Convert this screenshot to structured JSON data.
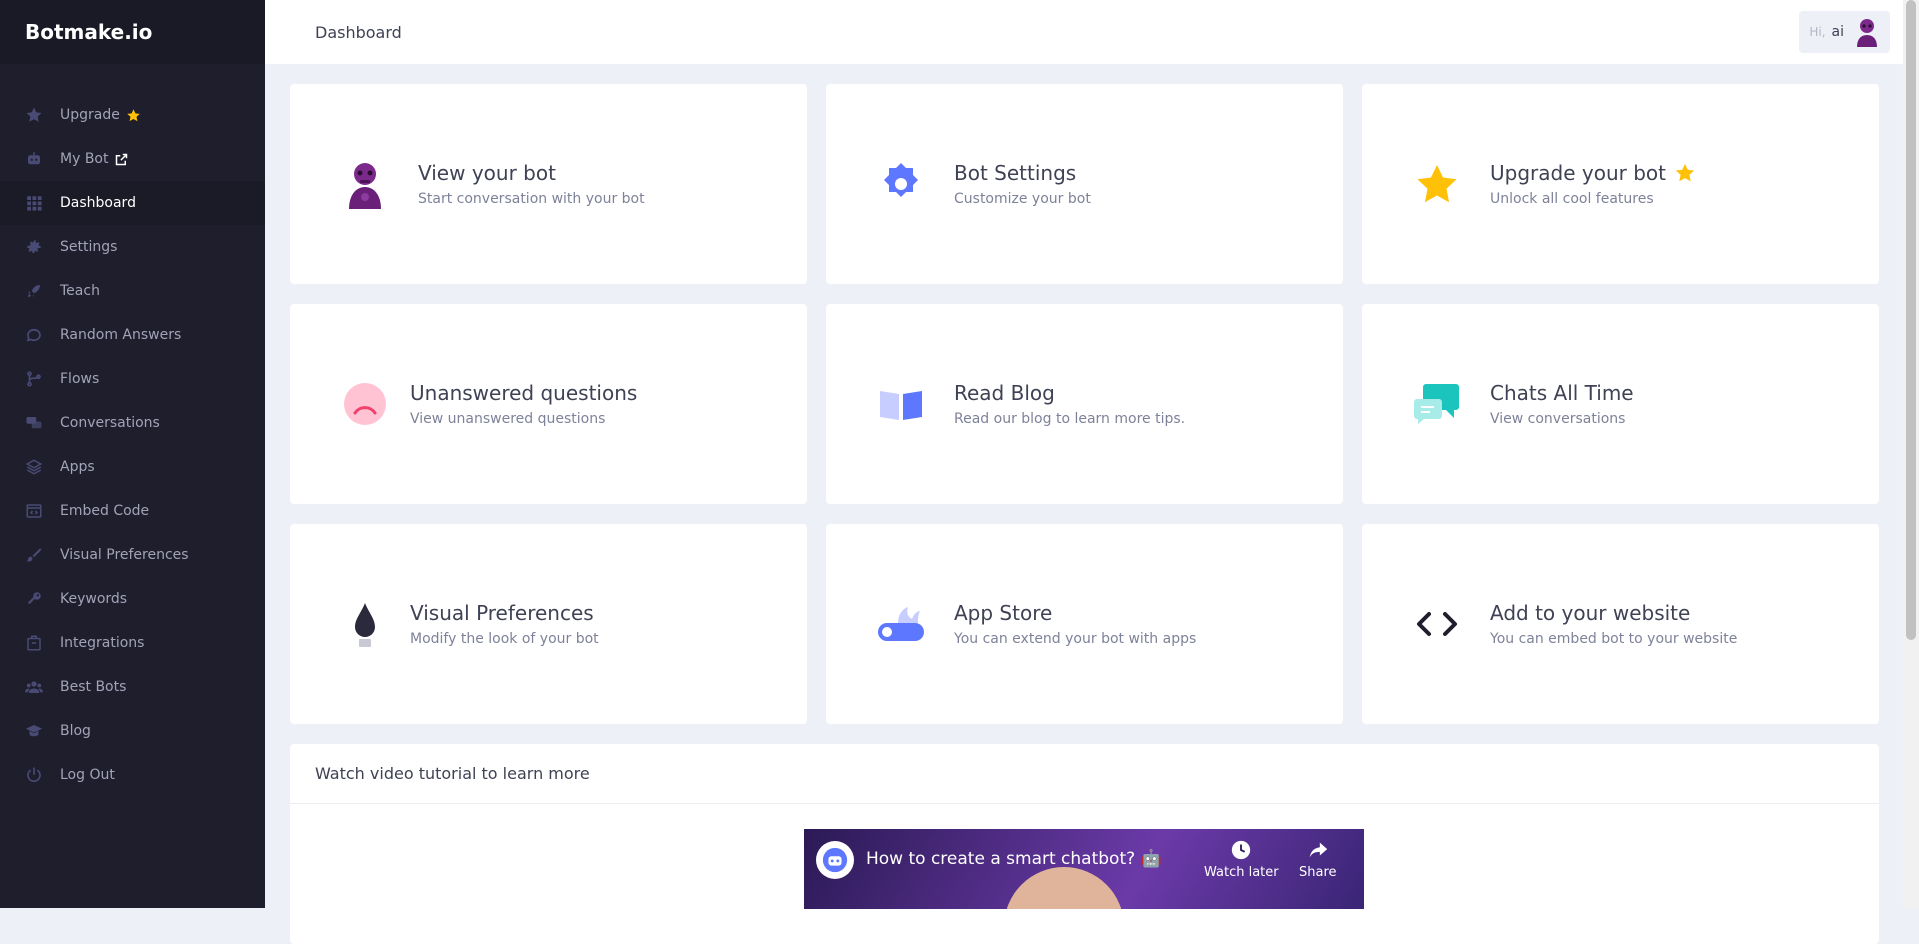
{
  "brand": "Botmake.io",
  "sidebar": {
    "items": [
      {
        "label": "Upgrade",
        "icon": "star-icon",
        "suffix": "star-badge-icon"
      },
      {
        "label": "My Bot",
        "icon": "robot-icon",
        "suffix": "external-link-icon"
      },
      {
        "label": "Dashboard",
        "icon": "grid-icon",
        "active": true
      },
      {
        "label": "Settings",
        "icon": "gear-icon"
      },
      {
        "label": "Teach",
        "icon": "rocket-icon"
      },
      {
        "label": "Random Answers",
        "icon": "chat-bubble-icon"
      },
      {
        "label": "Flows",
        "icon": "flow-icon"
      },
      {
        "label": "Conversations",
        "icon": "conversations-icon"
      },
      {
        "label": "Apps",
        "icon": "layers-icon"
      },
      {
        "label": "Embed Code",
        "icon": "code-window-icon"
      },
      {
        "label": "Visual Preferences",
        "icon": "brush-icon"
      },
      {
        "label": "Keywords",
        "icon": "key-icon"
      },
      {
        "label": "Integrations",
        "icon": "briefcase-icon"
      },
      {
        "label": "Best Bots",
        "icon": "users-icon"
      },
      {
        "label": "Blog",
        "icon": "graduation-cap-icon"
      },
      {
        "label": "Log Out",
        "icon": "power-icon"
      }
    ]
  },
  "header": {
    "title": "Dashboard",
    "greeting": "Hi,",
    "username": "ai"
  },
  "cards": [
    {
      "title": "View your bot",
      "subtitle": "Start conversation with your bot",
      "icon": "robot-avatar-icon"
    },
    {
      "title": "Bot Settings",
      "subtitle": "Customize your bot",
      "icon": "gear-badge-icon"
    },
    {
      "title": "Upgrade your bot",
      "subtitle": "Unlock all cool features",
      "icon": "star-icon"
    },
    {
      "title": "Unanswered questions",
      "subtitle": "View unanswered questions",
      "icon": "sad-face-icon"
    },
    {
      "title": "Read Blog",
      "subtitle": "Read our blog to learn more tips.",
      "icon": "book-icon"
    },
    {
      "title": "Chats All Time",
      "subtitle": "View conversations",
      "icon": "chat-bubbles-icon"
    },
    {
      "title": "Visual Preferences",
      "subtitle": "Modify the look of your bot",
      "icon": "ink-drop-icon"
    },
    {
      "title": "App Store",
      "subtitle": "You can extend your bot with apps",
      "icon": "toggle-app-icon"
    },
    {
      "title": "Add to your website",
      "subtitle": "You can embed bot to your website",
      "icon": "code-brackets-icon"
    }
  ],
  "video_section": {
    "heading": "Watch video tutorial to learn more",
    "video_title": "How to create a smart chatbot? 🤖",
    "watch_later": "Watch later",
    "share": "Share"
  },
  "colors": {
    "sidebar_bg": "#1e1e2d",
    "accent_blue": "#5d78ff",
    "star_yellow": "#ffc107",
    "green": "#1bc5bd",
    "pink": "#ffa7c0",
    "purple": "#7b2a8c"
  }
}
